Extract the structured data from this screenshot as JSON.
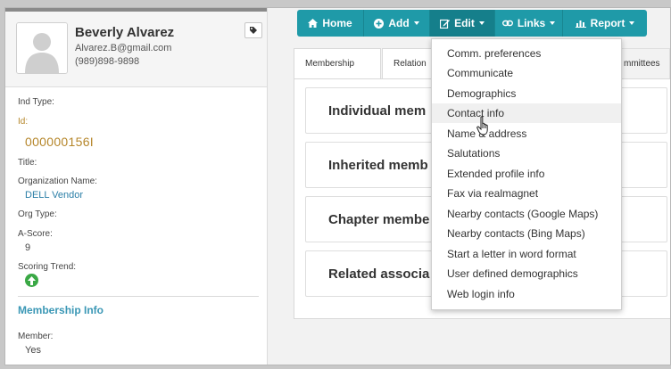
{
  "profile": {
    "name": "Beverly Alvarez",
    "email": "Alvarez.B@gmail.com",
    "phone": "(989)898-9898"
  },
  "fields": {
    "ind_type_label": "Ind Type:",
    "id_label": "Id:",
    "id_value": "000000156I",
    "title_label": "Title:",
    "org_name_label": "Organization Name:",
    "org_name_value": "DELL Vendor",
    "org_type_label": "Org Type:",
    "ascore_label": "A-Score:",
    "ascore_value": "9",
    "trend_label": "Scoring Trend:"
  },
  "membership_info": {
    "title": "Membership Info",
    "member_label": "Member:",
    "member_value": "Yes"
  },
  "toolbar": {
    "home": "Home",
    "add": "Add",
    "edit": "Edit",
    "links": "Links",
    "report": "Report"
  },
  "tabs": {
    "membership": "Membership",
    "relations": "Relation",
    "committees": "mmittees"
  },
  "cards": {
    "individual": "Individual mem",
    "inherited": "Inherited memb",
    "chapter": "Chapter membe",
    "related": "Related associa"
  },
  "edit_menu": {
    "items": [
      "Comm. preferences",
      "Communicate",
      "Demographics",
      "Contact info",
      "Name & address",
      "Salutations",
      "Extended profile info",
      "Fax via realmagnet",
      "Nearby contacts (Google Maps)",
      "Nearby contacts (Bing Maps)",
      "Start a letter in word format",
      "User defined demographics",
      "Web login info"
    ]
  },
  "colors": {
    "toolbar": "#1f9aa8",
    "accent_gold": "#b5862a",
    "link_blue": "#2a7ea6",
    "trend_green": "#3aa845"
  }
}
